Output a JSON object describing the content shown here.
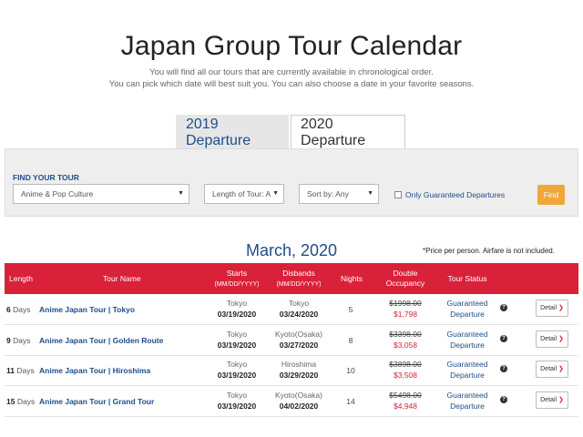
{
  "header": {
    "title": "Japan Group Tour Calendar",
    "intro_line1": "You will find all our tours that are currently available in chronological order.",
    "intro_line2": "You can pick which date will best suit you. You can also choose a date in your favorite seasons."
  },
  "tabs": [
    {
      "label": "2019 Departure",
      "active": false
    },
    {
      "label": "2020 Departure",
      "active": true
    }
  ],
  "finder": {
    "label": "FIND YOUR TOUR",
    "category": "Anime & Pop Culture",
    "length": "Length of Tour: A",
    "sort": "Sort by: Any",
    "guaranteed_label": "Only Guaranteed Departures",
    "find_label": "Find",
    "caret": "▼"
  },
  "month": "March, 2020",
  "price_note": "*Price per person. Airfare is not included.",
  "columns": {
    "length": "Length",
    "name": "Tour Name",
    "starts": "Starts",
    "starts_fmt": "(MM/DD/YYYY)",
    "disbands": "Disbands",
    "disbands_fmt": "(MM/DD/YYYY)",
    "nights": "Nights",
    "double1": "Double",
    "double2": "Occupancy",
    "status": "Tour Status"
  },
  "rows": [
    {
      "days": "6",
      "days_unit": "Days",
      "name": "Anime Japan Tour | Tokyo",
      "start_city": "Tokyo",
      "start_date": "03/19/2020",
      "end_city": "Tokyo",
      "end_date": "03/24/2020",
      "nights": "5",
      "old_price": "$1998.00",
      "new_price": "$1,798",
      "status1": "Guaranteed",
      "status2": "Departure",
      "info": "?",
      "detail": "Detail",
      "arrow": "❯"
    },
    {
      "days": "9",
      "days_unit": "Days",
      "name": "Anime Japan Tour | Golden Route",
      "start_city": "Tokyo",
      "start_date": "03/19/2020",
      "end_city": "Kyoto(Osaka)",
      "end_date": "03/27/2020",
      "nights": "8",
      "old_price": "$3398.00",
      "new_price": "$3,058",
      "status1": "Guaranteed",
      "status2": "Departure",
      "info": "?",
      "detail": "Detail",
      "arrow": "❯"
    },
    {
      "days": "11",
      "days_unit": "Days",
      "name": "Anime Japan Tour | Hiroshima",
      "start_city": "Tokyo",
      "start_date": "03/19/2020",
      "end_city": "Hiroshima",
      "end_date": "03/29/2020",
      "nights": "10",
      "old_price": "$3898.00",
      "new_price": "$3,508",
      "status1": "Guaranteed",
      "status2": "Departure",
      "info": "?",
      "detail": "Detail",
      "arrow": "❯"
    },
    {
      "days": "15",
      "days_unit": "Days",
      "name": "Anime Japan Tour | Grand Tour",
      "start_city": "Tokyo",
      "start_date": "03/19/2020",
      "end_city": "Kyoto(Osaka)",
      "end_date": "04/02/2020",
      "nights": "14",
      "old_price": "$5498.00",
      "new_price": "$4,948",
      "status1": "Guaranteed",
      "status2": "Departure",
      "info": "?",
      "detail": "Detail",
      "arrow": "❯"
    }
  ]
}
